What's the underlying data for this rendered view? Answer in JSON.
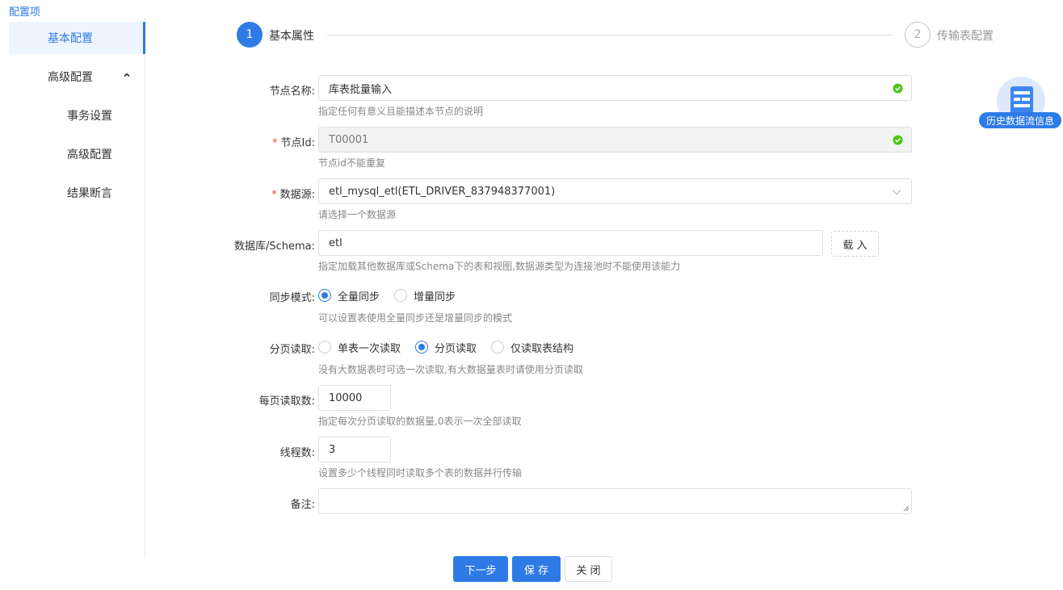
{
  "sidebar": {
    "title": "配置项",
    "items": [
      {
        "label": "基本配置"
      },
      {
        "label": "高级配置"
      },
      {
        "label": "事务设置"
      },
      {
        "label": "高级配置"
      },
      {
        "label": "结果断言"
      }
    ]
  },
  "steps": [
    {
      "number": "1",
      "label": "基本属性"
    },
    {
      "number": "2",
      "label": "传输表配置"
    }
  ],
  "form": {
    "node_name": {
      "label": "节点名称:",
      "value": "库表批量输入",
      "hint": "指定任何有意义且能描述本节点的说明"
    },
    "node_id": {
      "required": "*",
      "label": "节点Id:",
      "value": "T00001",
      "hint": "节点id不能重复"
    },
    "datasource": {
      "required": "*",
      "label": "数据源:",
      "value": "etl_mysql_etl(ETL_DRIVER_837948377001)",
      "hint": "请选择一个数据源"
    },
    "schema": {
      "label": "数据库/Schema:",
      "value": "etl",
      "load_button": "载 入",
      "hint": "指定加载其他数据库或Schema下的表和视图,数据源类型为连接池时不能使用该能力"
    },
    "sync_mode": {
      "label": "同步模式:",
      "options": [
        "全量同步",
        "增量同步"
      ],
      "selected": 0,
      "hint": "可以设置表使用全量同步还是增量同步的模式"
    },
    "page_read": {
      "label": "分页读取:",
      "options": [
        "单表一次读取",
        "分页读取",
        "仅读取表结构"
      ],
      "selected": 1,
      "hint": "没有大数据表时可选一次读取,有大数据量表时请使用分页读取"
    },
    "page_size": {
      "label": "每页读取数:",
      "value": "10000",
      "hint": "指定每次分页读取的数据量,0表示一次全部读取"
    },
    "threads": {
      "label": "线程数:",
      "value": "3",
      "hint": "设置多少个线程同时读取多个表的数据并行传输"
    },
    "remark": {
      "label": "备注:",
      "value": ""
    }
  },
  "buttons": {
    "next": "下一步",
    "save": "保 存",
    "close": "关 闭"
  },
  "history_widget": {
    "label": "历史数据流信息",
    "icon": "document-list-icon"
  },
  "colors": {
    "accent": "#2f7be6",
    "success": "#52c41a",
    "required": "#e04848"
  }
}
